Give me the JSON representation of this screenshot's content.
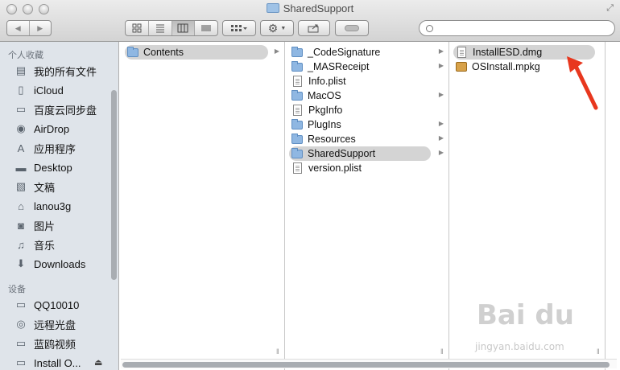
{
  "window": {
    "title": "SharedSupport"
  },
  "toolbar": {
    "back": "◀",
    "forward": "▶",
    "view_modes": [
      "icons",
      "list",
      "columns",
      "coverflow"
    ],
    "selected_view": "columns",
    "search_placeholder": ""
  },
  "sidebar": {
    "favorites_header": "个人收藏",
    "favorites": [
      {
        "label": "我的所有文件",
        "icon": "all-files-icon"
      },
      {
        "label": "iCloud",
        "icon": "document-icon"
      },
      {
        "label": "百度云同步盘",
        "icon": "folder-icon"
      },
      {
        "label": "AirDrop",
        "icon": "airdrop-icon"
      },
      {
        "label": "应用程序",
        "icon": "applications-icon"
      },
      {
        "label": "Desktop",
        "icon": "desktop-icon"
      },
      {
        "label": "文稿",
        "icon": "documents-icon"
      },
      {
        "label": "lanou3g",
        "icon": "home-icon"
      },
      {
        "label": "图片",
        "icon": "camera-icon"
      },
      {
        "label": "音乐",
        "icon": "music-icon"
      },
      {
        "label": "Downloads",
        "icon": "downloads-icon"
      }
    ],
    "devices_header": "设备",
    "devices": [
      {
        "label": "QQ10010",
        "icon": "drive-icon"
      },
      {
        "label": "远程光盘",
        "icon": "disc-icon"
      },
      {
        "label": "蓝鸥视频",
        "icon": "drive-icon"
      },
      {
        "label": "Install O...",
        "icon": "drive-icon"
      }
    ]
  },
  "columns": [
    {
      "items": [
        {
          "label": "Contents",
          "type": "folder",
          "arrow": true,
          "selected": true
        }
      ]
    },
    {
      "items": [
        {
          "label": "_CodeSignature",
          "type": "folder",
          "arrow": true
        },
        {
          "label": "_MASReceipt",
          "type": "folder",
          "arrow": true
        },
        {
          "label": "Info.plist",
          "type": "doc",
          "arrow": false
        },
        {
          "label": "MacOS",
          "type": "folder",
          "arrow": true
        },
        {
          "label": "PkgInfo",
          "type": "doc",
          "arrow": false
        },
        {
          "label": "PlugIns",
          "type": "folder",
          "arrow": true
        },
        {
          "label": "Resources",
          "type": "folder",
          "arrow": true
        },
        {
          "label": "SharedSupport",
          "type": "folder",
          "arrow": true,
          "selected": true
        },
        {
          "label": "version.plist",
          "type": "doc",
          "arrow": false
        }
      ]
    },
    {
      "items": [
        {
          "label": "InstallESD.dmg",
          "type": "doc",
          "arrow": false,
          "selected": true
        },
        {
          "label": "OSInstall.mpkg",
          "type": "pkg",
          "arrow": false
        }
      ]
    }
  ],
  "watermark": {
    "brand": "Bai du",
    "url": "jingyan.baidu.com"
  },
  "colors": {
    "accent_arrow": "#e8371e",
    "selection": "#d4d4d4",
    "sidebar_bg": "#dfe4ea"
  }
}
